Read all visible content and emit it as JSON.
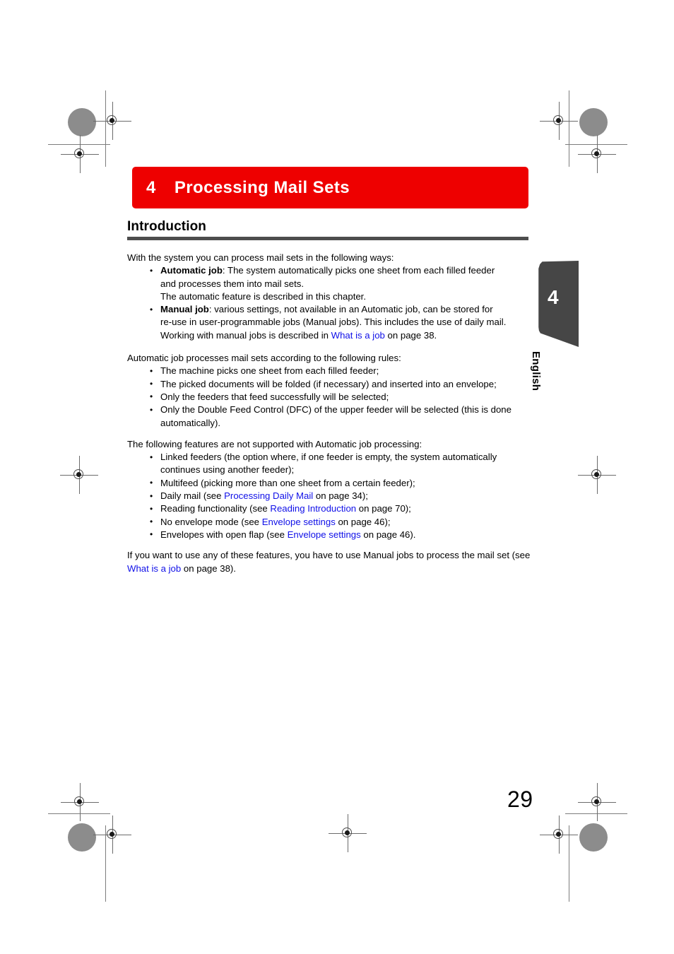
{
  "document": {
    "chapter_number": "4",
    "chapter_title": "Processing Mail Sets",
    "section_title": "Introduction",
    "page_number": "29",
    "side_tab": {
      "number": "4",
      "language": "English"
    },
    "colors": {
      "chapter_bar": "#ee0000",
      "section_rule": "#4d4d4d",
      "link": "#1010e8",
      "side_tab": "#464646",
      "registration_dot": "#8c8c8c"
    }
  },
  "content": {
    "intro_paragraph": "With the system you can process mail sets in the following ways:",
    "ways_list": [
      {
        "lead": "Automatic job",
        "line1_rest": ": The system automatically picks one sheet from each filled feeder",
        "line2": "and processes them into mail sets.",
        "line3": "The automatic feature is described in this chapter."
      },
      {
        "lead": "Manual job",
        "line1_rest": ": various settings, not available in an Automatic job, can be stored for",
        "line2": "re-use in user-programmable jobs (Manual jobs). This includes the use of daily mail.",
        "line3_pre": "Working with manual jobs is described in ",
        "line3_link": "What is a job",
        "line3_post": " on page 38."
      }
    ],
    "rules_intro": "Automatic job processes mail sets according to the following rules:",
    "rules_list": [
      "The machine picks one sheet from each filled feeder;",
      "The picked documents will be folded (if necessary) and inserted into an envelope;",
      "Only the feeders that feed successfully will be selected;",
      "Only the Double Feed Control (DFC) of the upper feeder will be selected (this is done automatically)."
    ],
    "unsupported_intro": "The following features are not supported with Automatic job processing:",
    "unsupported_list": [
      {
        "pre": "Linked feeders (the option where, if one feeder is empty, the system automatically continues using another feeder);",
        "link": "",
        "post": ""
      },
      {
        "pre": "Multifeed (picking more than one sheet from a certain feeder);",
        "link": "",
        "post": ""
      },
      {
        "pre": "Daily mail (see ",
        "link": "Processing Daily Mail",
        "post": " on page 34);"
      },
      {
        "pre": "Reading functionality (see ",
        "link": "Reading Introduction",
        "post": " on page 70);"
      },
      {
        "pre": "No envelope mode (see ",
        "link": "Envelope settings",
        "post": " on page 46);"
      },
      {
        "pre": "Envelopes with open flap (see ",
        "link": "Envelope settings",
        "post": " on page 46)."
      }
    ],
    "closing_paragraph": {
      "pre": "If you want to use any of these features, you have to use Manual jobs to process the mail set (see ",
      "link": "What is a job",
      "post": " on page 38)."
    }
  }
}
